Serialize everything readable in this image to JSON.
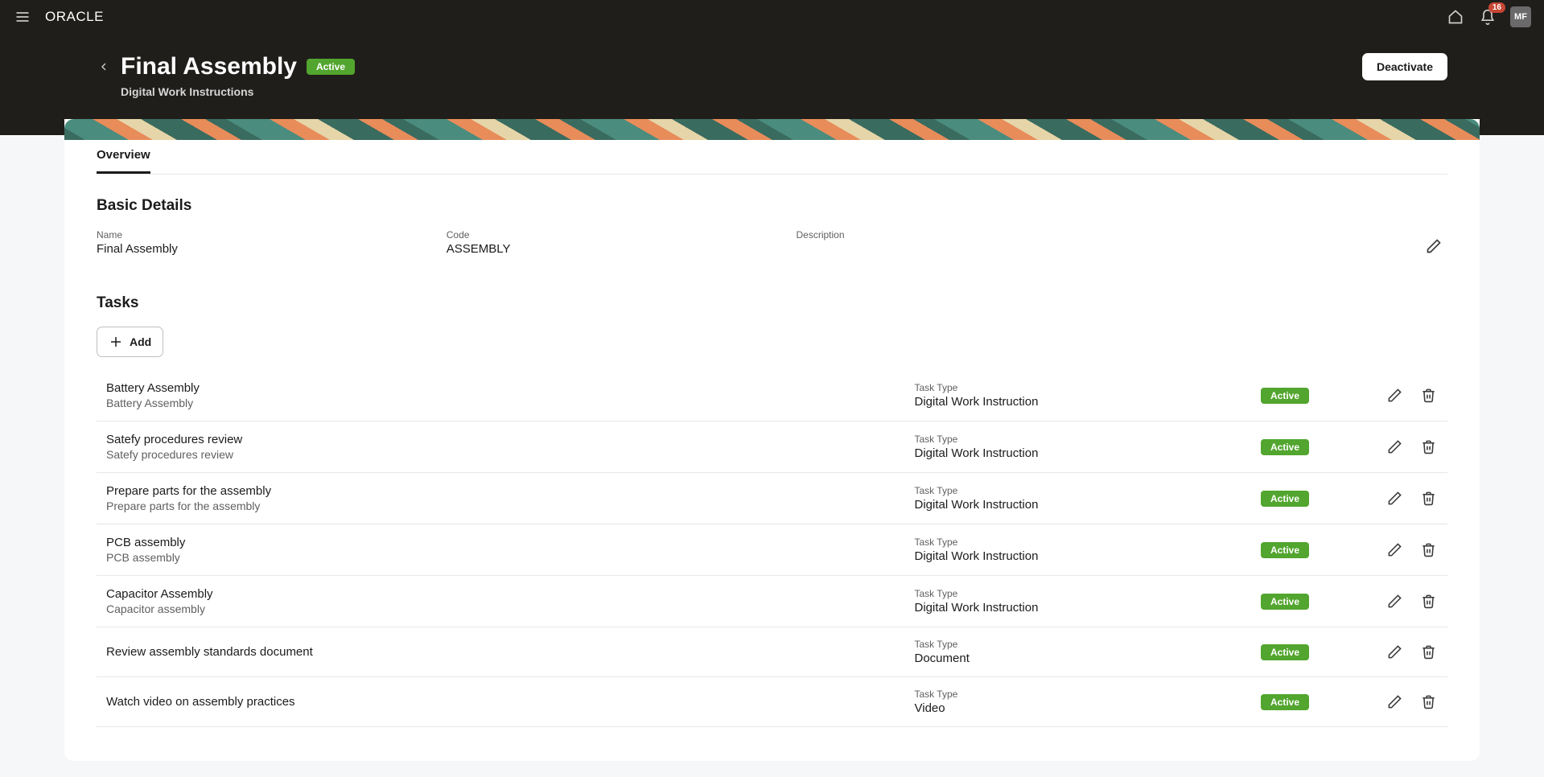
{
  "topbar": {
    "logo": "ORACLE",
    "notification_count": "16",
    "user_initials": "MF"
  },
  "header": {
    "title": "Final Assembly",
    "status": "Active",
    "subtitle": "Digital Work Instructions",
    "deactivate_label": "Deactivate"
  },
  "tabs": [
    {
      "label": "Overview",
      "active": true
    }
  ],
  "basic_details": {
    "section_title": "Basic Details",
    "name_label": "Name",
    "name_value": "Final Assembly",
    "code_label": "Code",
    "code_value": "ASSEMBLY",
    "description_label": "Description",
    "description_value": ""
  },
  "tasks_section": {
    "title": "Tasks",
    "add_label": "Add",
    "type_label": "Task Type",
    "items": [
      {
        "title": "Battery Assembly",
        "subtitle": "Battery Assembly",
        "type": "Digital Work Instruction",
        "status": "Active"
      },
      {
        "title": "Satefy procedures review",
        "subtitle": "Satefy procedures review",
        "type": "Digital Work Instruction",
        "status": "Active"
      },
      {
        "title": "Prepare parts for the assembly",
        "subtitle": "Prepare parts for the assembly",
        "type": "Digital Work Instruction",
        "status": "Active"
      },
      {
        "title": "PCB assembly",
        "subtitle": "PCB assembly",
        "type": "Digital Work Instruction",
        "status": "Active"
      },
      {
        "title": "Capacitor Assembly",
        "subtitle": "Capacitor assembly",
        "type": "Digital Work Instruction",
        "status": "Active"
      },
      {
        "title": "Review assembly standards document",
        "subtitle": "",
        "type": "Document",
        "status": "Active"
      },
      {
        "title": "Watch video on assembly practices",
        "subtitle": "",
        "type": "Video",
        "status": "Active"
      }
    ]
  }
}
